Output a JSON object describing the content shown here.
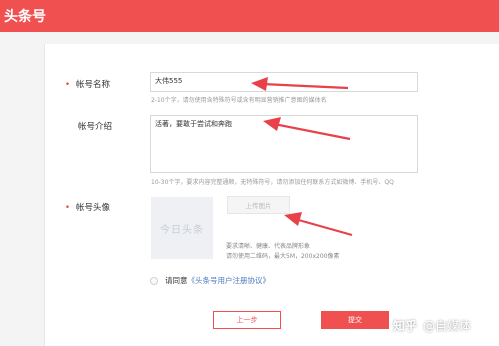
{
  "app": {
    "title": "头条号"
  },
  "form": {
    "name_label": "帐号名称",
    "name_value": "大伟555",
    "name_hint": "2-10个字，请勿使用含特殊符号或含有明显营销推广意图的媒体名",
    "intro_label": "帐号介绍",
    "intro_value": "活著，要敢于尝试和奔跑",
    "intro_hint": "10-30个字，要求内容完整通顺，无特殊符号，请勿添加任何联系方式如微博、手机号、QQ",
    "avatar_label": "帐号头像",
    "avatar_placeholder": "今日头条",
    "upload_label": "上传图片",
    "avatar_hint_1": "要求清晰、健康、代表品牌形象",
    "avatar_hint_2": "请勿使用二维码，最大5M，200x200像素",
    "agree_prefix": "请同意",
    "agree_link": "《头条号用户注册协议》",
    "required_mark": "•"
  },
  "actions": {
    "prev_label": "上一步",
    "submit_label": "提交"
  },
  "watermark": {
    "logo": "知乎",
    "text": "@自媒体"
  },
  "colors": {
    "brand": "#f05050",
    "arrow": "#e8414a",
    "link": "#4a78c0"
  }
}
